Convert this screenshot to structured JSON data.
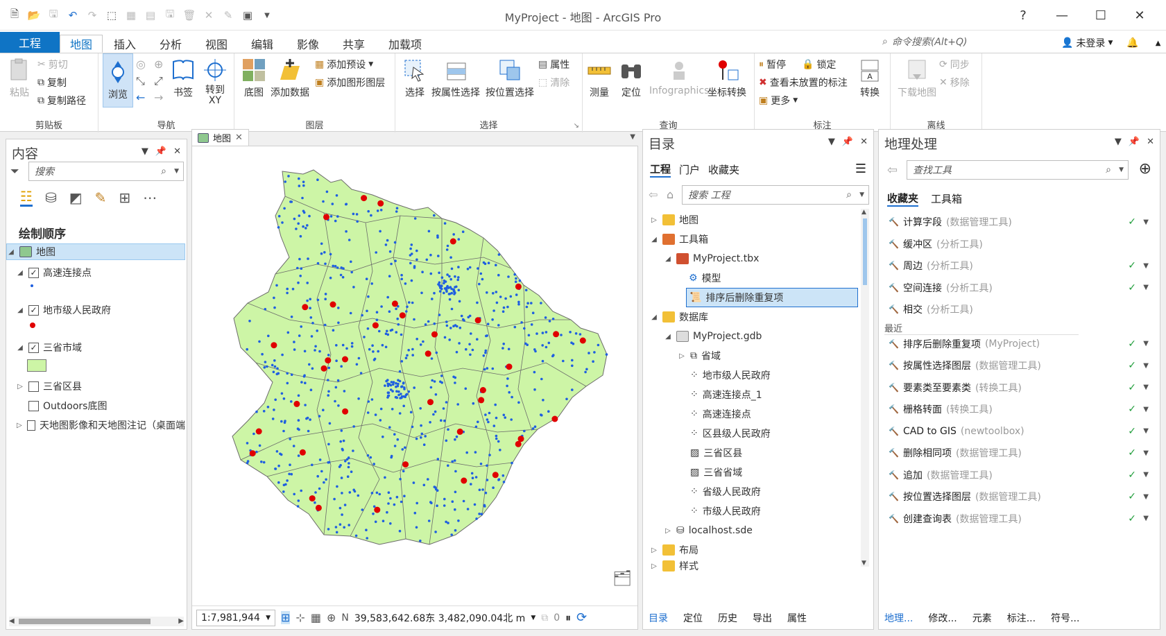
{
  "app": {
    "title": "MyProject - 地图 - ArcGIS Pro",
    "help": "?",
    "minimize": "—",
    "maximize": "☐",
    "close": "✕"
  },
  "tabs": [
    "工程",
    "地图",
    "插入",
    "分析",
    "视图",
    "编辑",
    "影像",
    "共享",
    "加载项"
  ],
  "command_search": {
    "placeholder": "命令搜索(Alt+Q)"
  },
  "signin": {
    "label": "未登录"
  },
  "ribbon": {
    "clipboard": {
      "label": "剪贴板",
      "paste": "粘贴",
      "cut": "剪切",
      "copy": "复制",
      "copy_path": "复制路径"
    },
    "navigate": {
      "label": "导航",
      "explore": "浏览",
      "bookmarks": "书签",
      "goto_xy": "转到\nXY"
    },
    "layer": {
      "label": "图层",
      "basemap": "底图",
      "add_data": "添加数据",
      "add_preset": "添加预设",
      "add_graphics_layer": "添加图形图层"
    },
    "selection": {
      "label": "选择",
      "select": "选择",
      "select_by_attr": "按属性选择",
      "select_by_loc": "按位置选择",
      "attributes": "属性",
      "clear": "清除"
    },
    "inquiry": {
      "label": "查询",
      "measure": "测量",
      "locate": "定位",
      "infographics": "Infographics",
      "coord_conv": "坐标转换"
    },
    "labeling": {
      "label": "标注",
      "pause": "暂停",
      "lock": "锁定",
      "unplaced": "查看未放置的标注",
      "more": "更多",
      "convert": "转换"
    },
    "offline": {
      "label": "离线",
      "download_map": "下载地图",
      "sync": "同步",
      "remove": "移除"
    }
  },
  "contents": {
    "title": "内容",
    "search_placeholder": "搜索",
    "drawing_order": "绘制顺序",
    "layers": [
      {
        "name": "地图"
      },
      {
        "name": "高速连接点"
      },
      {
        "name": "地市级人民政府"
      },
      {
        "name": "三省市域"
      },
      {
        "name": "三省区县"
      },
      {
        "name": "Outdoors底图"
      },
      {
        "name": "天地图影像和天地图注记（桌面端"
      }
    ]
  },
  "map_view": {
    "tab": "地图",
    "scale": "1:7,981,944",
    "coords": "39,583,642.68东 3,482,090.04北 m",
    "selected_count": "0"
  },
  "catalog": {
    "title": "目录",
    "tabs": [
      "工程",
      "门户",
      "收藏夹"
    ],
    "search_placeholder": "搜索 工程",
    "items": [
      "地图",
      "工具箱",
      "MyProject.tbx",
      "模型",
      "排序后删除重复项",
      "数据库",
      "MyProject.gdb",
      "省域",
      "地市级人民政府",
      "高速连接点_1",
      "高速连接点",
      "区县级人民政府",
      "三省区县",
      "三省省域",
      "省级人民政府",
      "市级人民政府",
      "localhost.sde",
      "布局",
      "样式"
    ],
    "bottom_tabs": [
      "目录",
      "定位",
      "历史",
      "导出",
      "属性"
    ]
  },
  "geoprocessing": {
    "title": "地理处理",
    "search_placeholder": "查找工具",
    "tabs": [
      "收藏夹",
      "工具箱"
    ],
    "recent_label": "最近",
    "favorites": [
      {
        "name": "计算字段",
        "src": "(数据管理工具)",
        "ok": true
      },
      {
        "name": "缓冲区",
        "src": "(分析工具)",
        "ok": false
      },
      {
        "name": "周边",
        "src": "(分析工具)",
        "ok": true
      },
      {
        "name": "空间连接",
        "src": "(分析工具)",
        "ok": true
      },
      {
        "name": "相交",
        "src": "(分析工具)",
        "ok": false
      }
    ],
    "recent": [
      {
        "name": "排序后删除重复项",
        "src": "(MyProject)"
      },
      {
        "name": "按属性选择图层",
        "src": "(数据管理工具)"
      },
      {
        "name": "要素类至要素类",
        "src": "(转换工具)"
      },
      {
        "name": "栅格转面",
        "src": "(转换工具)"
      },
      {
        "name": "CAD to GIS",
        "src": "(newtoolbox)"
      },
      {
        "name": "删除相同项",
        "src": "(数据管理工具)"
      },
      {
        "name": "追加",
        "src": "(数据管理工具)"
      },
      {
        "name": "按位置选择图层",
        "src": "(数据管理工具)"
      },
      {
        "name": "创建查询表",
        "src": "(数据管理工具)"
      }
    ],
    "bottom_tabs": [
      "地理...",
      "修改...",
      "元素",
      "标注...",
      "符号..."
    ]
  },
  "colors": {
    "accent": "#0f74c5",
    "polygon_fill": "#cdf5a6",
    "point_blue": "#1f5fe0",
    "point_red": "#e00000"
  }
}
